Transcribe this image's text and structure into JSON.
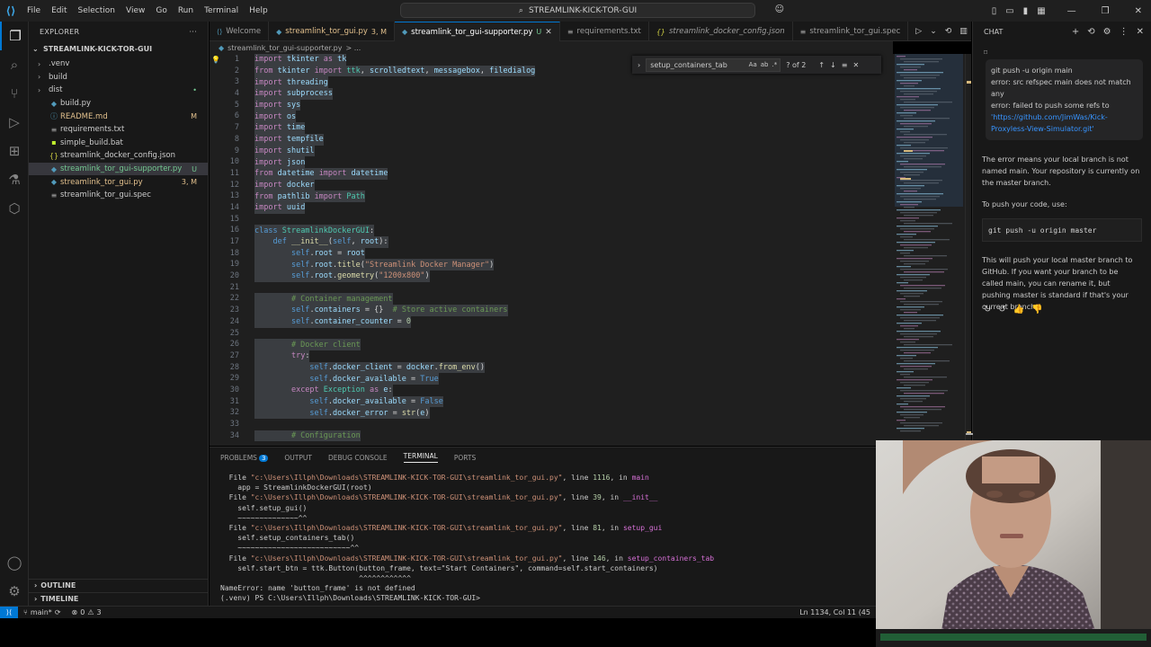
{
  "titlebar": {
    "menu": [
      "File",
      "Edit",
      "Selection",
      "View",
      "Go",
      "Run",
      "Terminal",
      "Help"
    ],
    "search": "STREAMLINK-KICK-TOR-GUI"
  },
  "explorer": {
    "header": "EXPLORER",
    "root": "STREAMLINK-KICK-TOR-GUI",
    "items": [
      {
        "label": ".venv",
        "kind": "folder",
        "badge": ""
      },
      {
        "label": "build",
        "kind": "folder",
        "badge": ""
      },
      {
        "label": "dist",
        "kind": "folder",
        "badge": "•"
      },
      {
        "label": "build.py",
        "kind": "py",
        "badge": ""
      },
      {
        "label": "README.md",
        "kind": "md",
        "badge": "M"
      },
      {
        "label": "requirements.txt",
        "kind": "txt",
        "badge": ""
      },
      {
        "label": "simple_build.bat",
        "kind": "bat",
        "badge": ""
      },
      {
        "label": "streamlink_docker_config.json",
        "kind": "json",
        "badge": ""
      },
      {
        "label": "streamlink_tor_gui-supporter.py",
        "kind": "py",
        "badge": "U"
      },
      {
        "label": "streamlink_tor_gui.py",
        "kind": "py",
        "badge": "3, M"
      },
      {
        "label": "streamlink_tor_gui.spec",
        "kind": "spec",
        "badge": ""
      }
    ],
    "outline": "OUTLINE",
    "timeline": "TIMELINE"
  },
  "tabs": [
    {
      "label": "Welcome",
      "badge": "",
      "active": false
    },
    {
      "label": "streamlink_tor_gui.py",
      "badge": "3, M",
      "active": false
    },
    {
      "label": "streamlink_tor_gui-supporter.py",
      "badge": "U",
      "active": true
    },
    {
      "label": "requirements.txt",
      "badge": "",
      "active": false
    },
    {
      "label": "streamlink_docker_config.json",
      "badge": "",
      "active": false
    },
    {
      "label": "streamlink_tor_gui.spec",
      "badge": "",
      "active": false
    }
  ],
  "breadcrumb": {
    "file": "streamlink_tor_gui-supporter.py",
    "rest": "> ..."
  },
  "find": {
    "query": "setup_containers_tab",
    "result": "? of 2",
    "opts": [
      "Aa",
      "ab",
      ".*"
    ]
  },
  "code": [
    {
      "n": "1",
      "t": "import tkinter as tk"
    },
    {
      "n": "2",
      "t": "from tkinter import ttk, scrolledtext, messagebox, filedialog"
    },
    {
      "n": "3",
      "t": "import threading"
    },
    {
      "n": "4",
      "t": "import subprocess"
    },
    {
      "n": "5",
      "t": "import sys"
    },
    {
      "n": "6",
      "t": "import os"
    },
    {
      "n": "7",
      "t": "import time"
    },
    {
      "n": "8",
      "t": "import tempfile"
    },
    {
      "n": "9",
      "t": "import shutil"
    },
    {
      "n": "10",
      "t": "import json"
    },
    {
      "n": "11",
      "t": "from datetime import datetime"
    },
    {
      "n": "12",
      "t": "import docker"
    },
    {
      "n": "13",
      "t": "from pathlib import Path"
    },
    {
      "n": "14",
      "t": "import uuid"
    },
    {
      "n": "15",
      "t": ""
    },
    {
      "n": "16",
      "t": "class StreamlinkDockerGUI:"
    },
    {
      "n": "17",
      "t": "    def __init__(self, root):"
    },
    {
      "n": "18",
      "t": "        self.root = root"
    },
    {
      "n": "19",
      "t": "        self.root.title(\"Streamlink Docker Manager\")"
    },
    {
      "n": "20",
      "t": "        self.root.geometry(\"1200x800\")"
    },
    {
      "n": "21",
      "t": ""
    },
    {
      "n": "22",
      "t": "        # Container management"
    },
    {
      "n": "23",
      "t": "        self.containers = {}  # Store active containers"
    },
    {
      "n": "24",
      "t": "        self.container_counter = 0"
    },
    {
      "n": "25",
      "t": ""
    },
    {
      "n": "26",
      "t": "        # Docker client"
    },
    {
      "n": "27",
      "t": "        try:"
    },
    {
      "n": "28",
      "t": "            self.docker_client = docker.from_env()"
    },
    {
      "n": "29",
      "t": "            self.docker_available = True"
    },
    {
      "n": "30",
      "t": "        except Exception as e:"
    },
    {
      "n": "31",
      "t": "            self.docker_available = False"
    },
    {
      "n": "32",
      "t": "            self.docker_error = str(e)"
    },
    {
      "n": "33",
      "t": ""
    },
    {
      "n": "34",
      "t": "        # Configuration"
    }
  ],
  "panel": {
    "tabs": [
      "PROBLEMS",
      "OUTPUT",
      "DEBUG CONSOLE",
      "TERMINAL",
      "PORTS"
    ],
    "problems_count": "3",
    "terminal": [
      {
        "c": "  File \"c:\\Users\\Illph\\Downloads\\STREAMLINK-KICK-TOR-GUI\\streamlink_tor_gui.py\", line 1116, in main"
      },
      {
        "c": "    app = StreamlinkDockerGUI(root)"
      },
      {
        "c": "  File \"c:\\Users\\Illph\\Downloads\\STREAMLINK-KICK-TOR-GUI\\streamlink_tor_gui.py\", line 39, in __init__"
      },
      {
        "c": "    self.setup_gui()"
      },
      {
        "c": "    ~~~~~~~~~~~~~~^^"
      },
      {
        "c": "  File \"c:\\Users\\Illph\\Downloads\\STREAMLINK-KICK-TOR-GUI\\streamlink_tor_gui.py\", line 81, in setup_gui"
      },
      {
        "c": "    self.setup_containers_tab()"
      },
      {
        "c": "    ~~~~~~~~~~~~~~~~~~~~~~~~~~^^"
      },
      {
        "c": "  File \"c:\\Users\\Illph\\Downloads\\STREAMLINK-KICK-TOR-GUI\\streamlink_tor_gui.py\", line 146, in setup_containers_tab"
      },
      {
        "c": "    self.start_btn = ttk.Button(button_frame, text=\"Start Containers\", command=self.start_containers)"
      },
      {
        "c": "                                ^^^^^^^^^^^^"
      },
      {
        "c": "NameError: name 'button_frame' is not defined"
      },
      {
        "c": "(.venv) PS C:\\Users\\Illph\\Downloads\\STREAMLINK-KICK-TOR-GUI>"
      }
    ]
  },
  "chat": {
    "header": "CHAT",
    "request_lines": [
      "git push -u origin main",
      "error: src refspec main does not match any",
      "error: failed to push some refs to"
    ],
    "request_link": "'https://github.com/JimWas/Kick-Proxyless-View-Simulator.git'",
    "resp1": "The error means your local branch is not named main. Your repository is currently on the master branch.",
    "resp2": "To push your code, use:",
    "code": "git push -u origin master",
    "resp3": "This will push your local master branch to GitHub. If you want your branch to be called main, you can rename it, but pushing master is standard if that's your current branch."
  },
  "status": {
    "branch": "main*",
    "errors": "0",
    "warnings": "3",
    "position": "Ln 1134, Col 11 (45"
  },
  "colors": {
    "accent": "#0078d4",
    "editor_bg": "#1f1f1f",
    "sidebar_bg": "#181818"
  }
}
